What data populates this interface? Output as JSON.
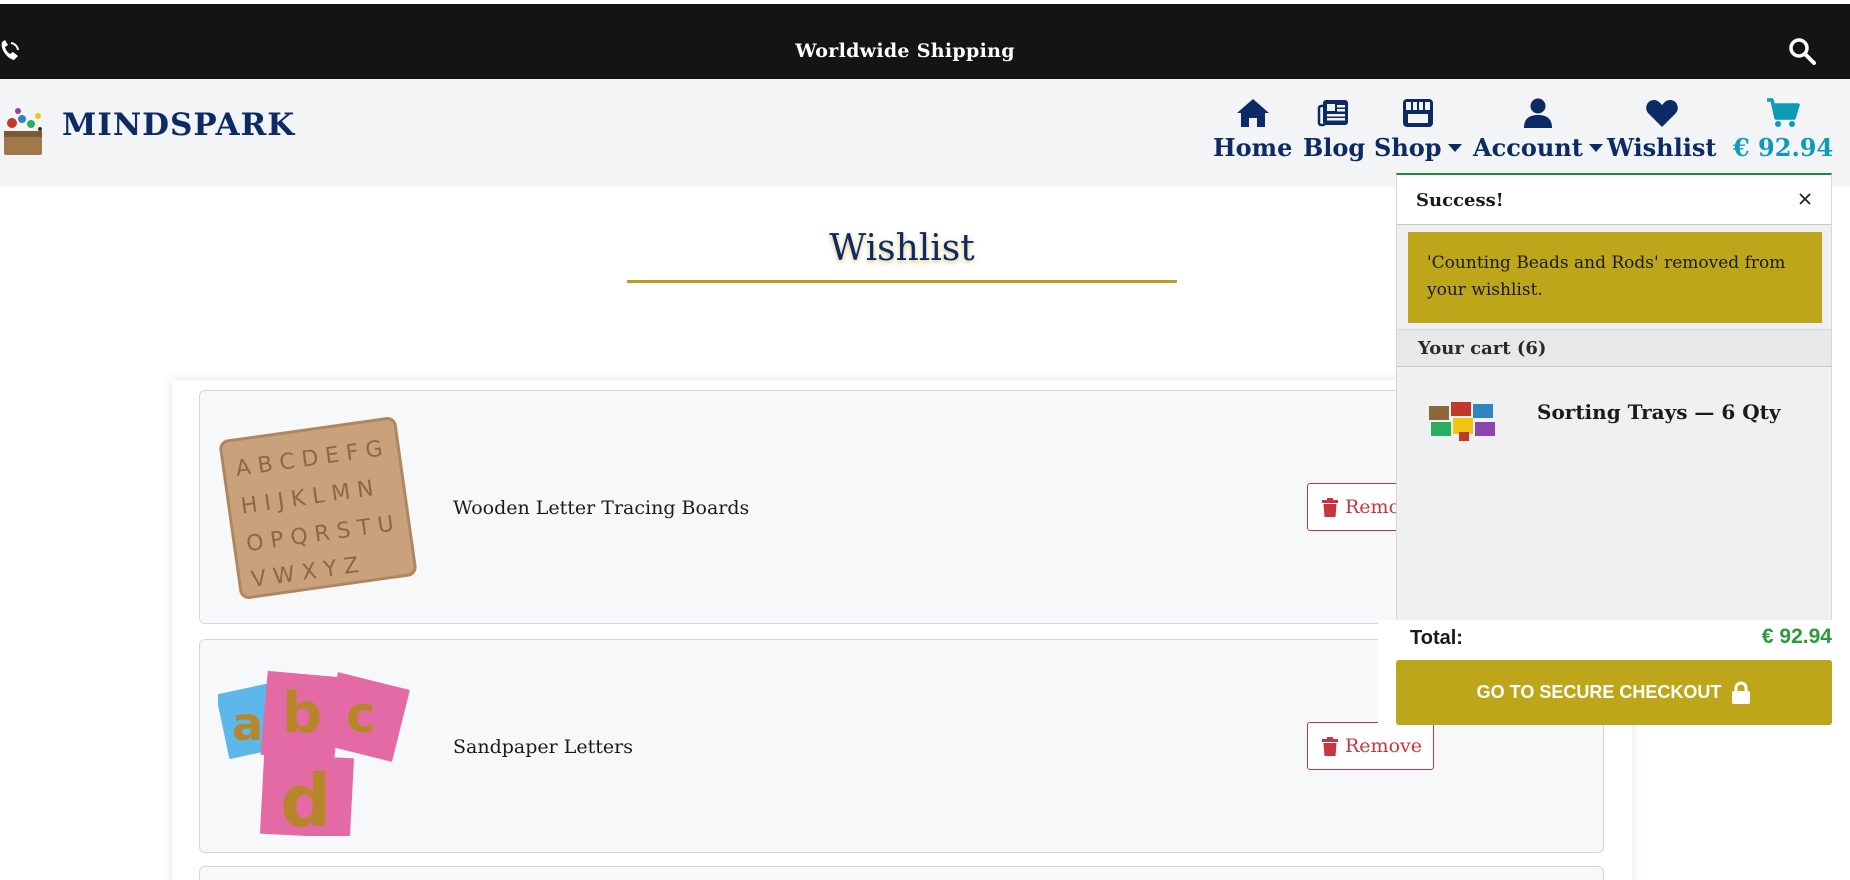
{
  "topbar": {
    "shipping_text": "Worldwide Shipping",
    "left_icon": "phone-icon",
    "right_icon": "search-icon"
  },
  "header": {
    "brand": "MINDSPARK",
    "nav": {
      "home": "Home",
      "blog": "Blog",
      "shop": "Shop",
      "account": "Account",
      "wishlist": "Wishlist",
      "cart_total": "€ 92.94"
    },
    "icons": [
      "home-icon",
      "blog-icon",
      "store-icon",
      "user-icon",
      "heart-icon",
      "cart-icon"
    ]
  },
  "page": {
    "title": "Wishlist"
  },
  "wishlist": {
    "items": [
      {
        "name": "Wooden Letter Tracing Boards",
        "remove_label": "Remove"
      },
      {
        "name": "Sandpaper Letters",
        "remove_label": "Remove"
      }
    ]
  },
  "flyout": {
    "title": "Success!",
    "message": "'Counting Beads and Rods' removed from your wishlist.",
    "cart_label": "Your cart (6)",
    "cart_item": "Sorting Trays — 6 Qty",
    "total_label": "Total:",
    "total_value": "€ 92.94",
    "checkout_label": "GO TO SECURE CHECKOUT"
  },
  "colors": {
    "navy": "#0b2a66",
    "gold": "#bda619",
    "cart_teal": "#0d9bb8",
    "success_green": "#1f8a3a",
    "remove_red": "#c8343f",
    "total_green": "#2a9a3a"
  }
}
